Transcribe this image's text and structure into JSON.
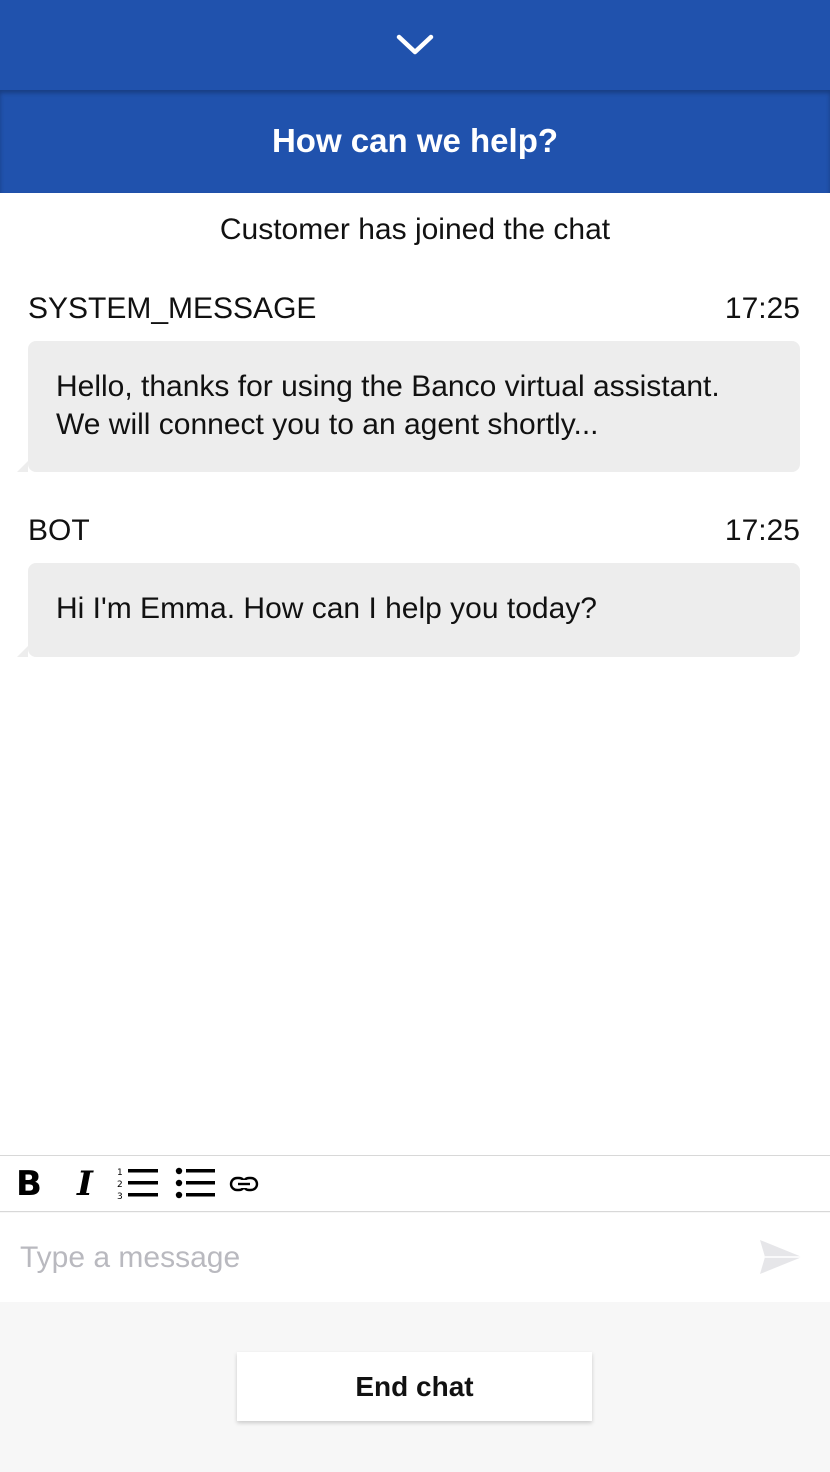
{
  "collapse": {
    "icon": "chevron-down-icon"
  },
  "header": {
    "title": "How can we help?"
  },
  "chat": {
    "join_notice": "Customer has joined the chat",
    "messages": [
      {
        "sender": "SYSTEM_MESSAGE",
        "time": "17:25",
        "lines": [
          "Hello, thanks for using the Banco virtual assistant.",
          "We will connect you to an agent shortly..."
        ]
      },
      {
        "sender": "BOT",
        "time": "17:25",
        "lines": [
          "Hi I'm Emma. How can I help you today?"
        ]
      }
    ]
  },
  "toolbar": {
    "bold_glyph": "B",
    "italic_glyph": "I",
    "icons": [
      "bold-icon",
      "italic-icon",
      "numbered-list-icon",
      "bullet-list-icon",
      "link-icon"
    ]
  },
  "composer": {
    "placeholder": "Type a message",
    "send_icon": "send-icon"
  },
  "footer": {
    "end_chat_label": "End chat"
  },
  "colors": {
    "brand_blue": "#2052ad",
    "bubble_gray": "#ededed",
    "placeholder_gray": "#b9b9bf",
    "footer_bg": "#f7f7f7"
  }
}
